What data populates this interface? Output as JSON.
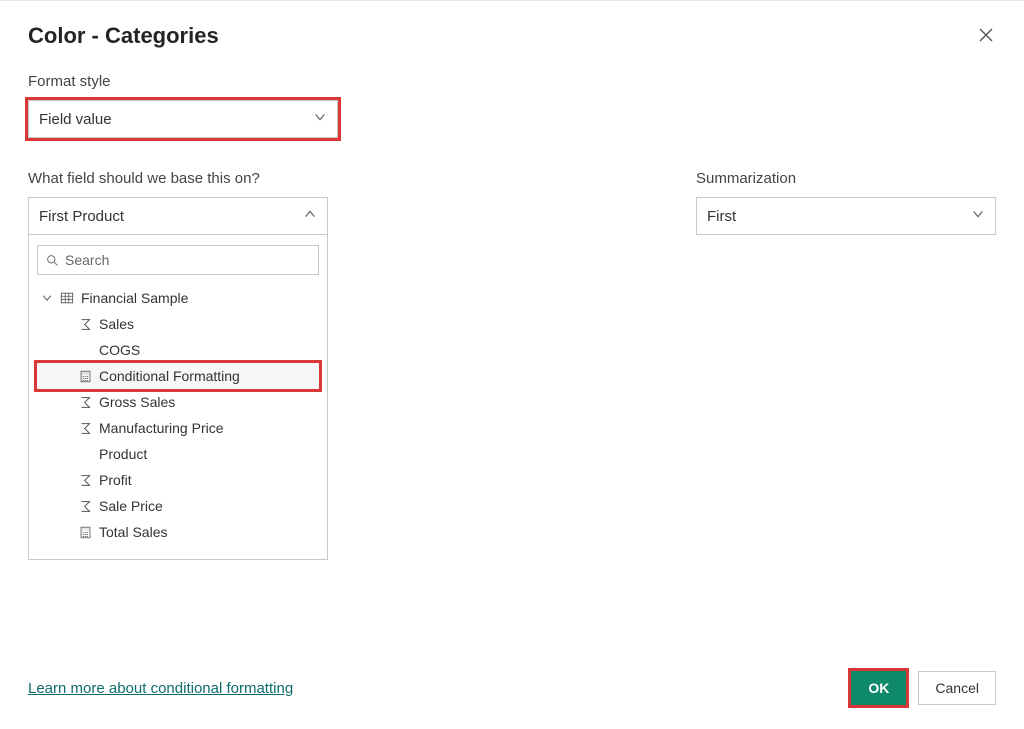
{
  "dialog": {
    "title": "Color - Categories"
  },
  "format_style": {
    "label": "Format style",
    "value": "Field value"
  },
  "field_basis": {
    "label": "What field should we base this on?",
    "value": "First Product",
    "search_placeholder": "Search"
  },
  "summarization": {
    "label": "Summarization",
    "value": "First"
  },
  "tree": {
    "table_name": "Financial Sample",
    "items": [
      {
        "label": "Sales",
        "icon": "sigma"
      },
      {
        "label": "COGS",
        "icon": "none"
      },
      {
        "label": "Conditional Formatting",
        "icon": "calc",
        "highlighted": true
      },
      {
        "label": "Gross Sales",
        "icon": "sigma"
      },
      {
        "label": "Manufacturing Price",
        "icon": "sigma"
      },
      {
        "label": "Product",
        "icon": "none"
      },
      {
        "label": "Profit",
        "icon": "sigma"
      },
      {
        "label": "Sale Price",
        "icon": "sigma"
      },
      {
        "label": "Total Sales",
        "icon": "calc"
      }
    ]
  },
  "footer": {
    "learn_more": "Learn more about conditional formatting",
    "ok": "OK",
    "cancel": "Cancel"
  }
}
